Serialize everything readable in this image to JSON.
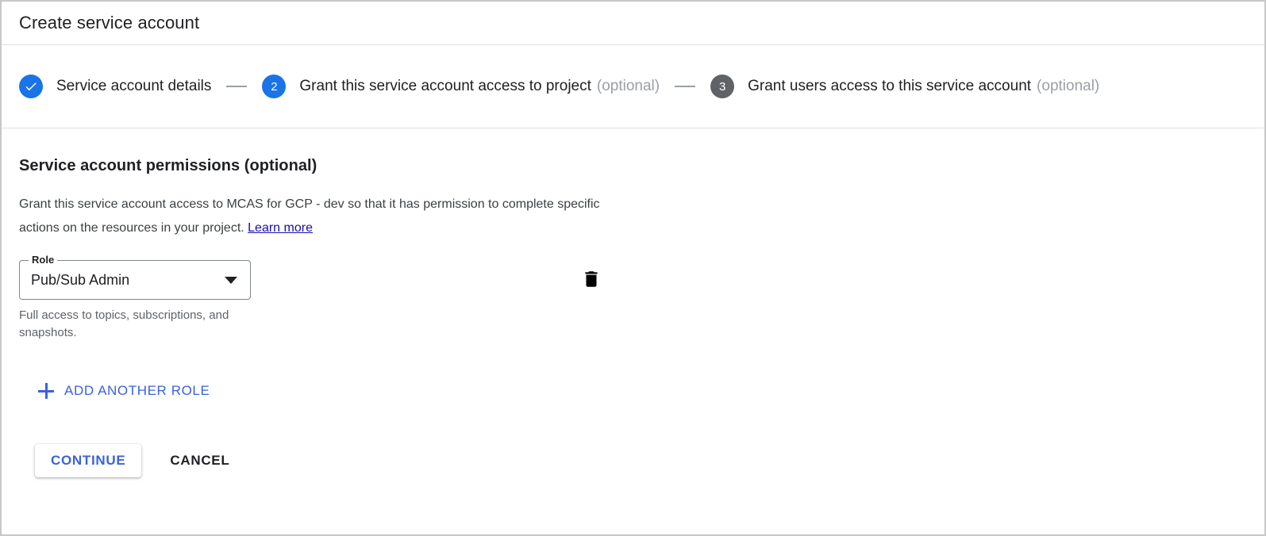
{
  "window": {
    "title": "Create service account"
  },
  "stepper": {
    "steps": [
      {
        "badge": "check-icon",
        "state": "done",
        "label": "Service account details",
        "optional": ""
      },
      {
        "badge": "2",
        "state": "active",
        "label": "Grant this service account access to project",
        "optional": "(optional)"
      },
      {
        "badge": "3",
        "state": "idle",
        "label": "Grant users access to this service account",
        "optional": "(optional)"
      }
    ]
  },
  "main": {
    "heading": "Service account permissions (optional)",
    "description_part1": "Grant this service account access to MCAS for GCP - dev so that it has permission to complete specific actions on the resources in your project.",
    "learn_more": "Learn more",
    "role_field": {
      "label": "Role",
      "value": "Pub/Sub Admin",
      "helper": "Full access to topics, subscriptions, and snapshots."
    },
    "delete_role_icon": "trash-icon",
    "add_another_role": "ADD ANOTHER ROLE"
  },
  "footer": {
    "continue_label": "CONTINUE",
    "cancel_label": "CANCEL"
  },
  "colors": {
    "accent_blue": "#1a73e8",
    "button_blue": "#3b62d9",
    "link_blue": "#1a0dab",
    "idle_grey": "#5f6368",
    "muted_text": "#9aa0a6"
  }
}
